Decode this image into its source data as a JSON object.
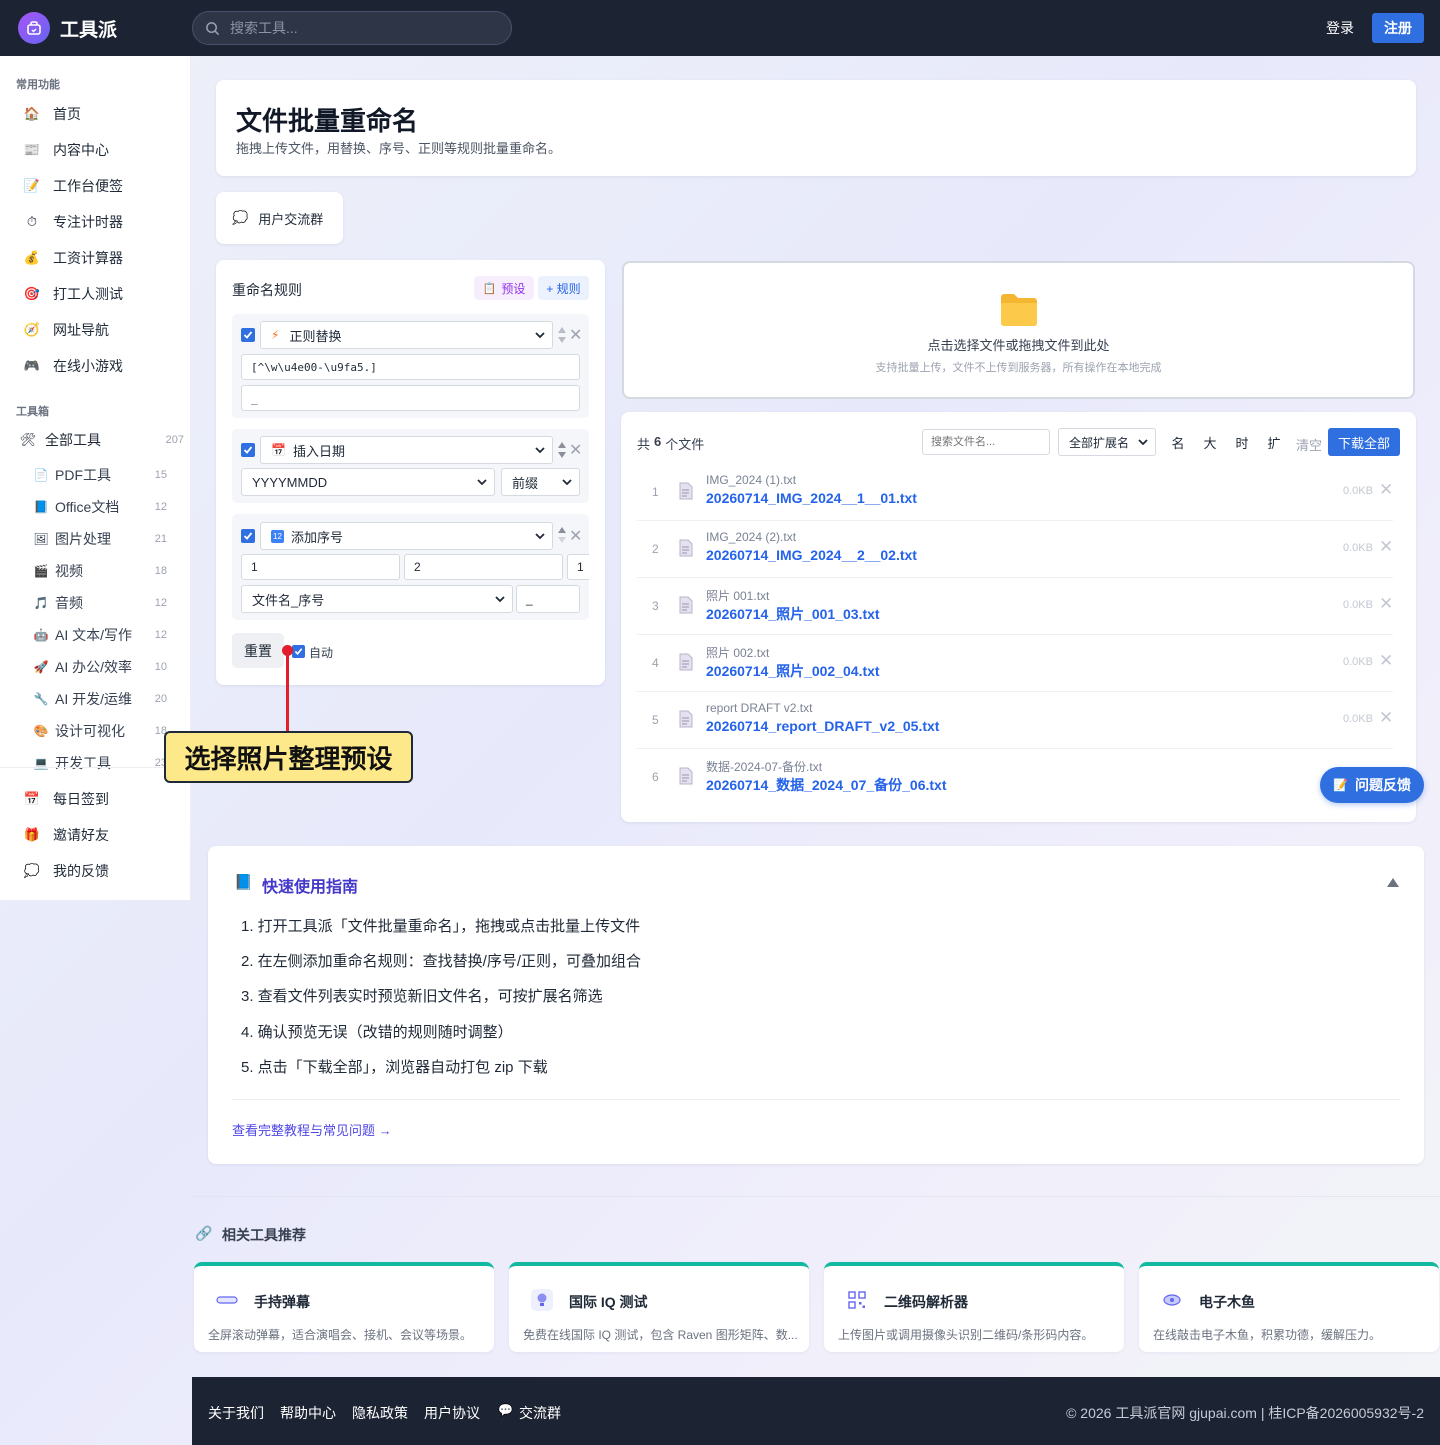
{
  "header": {
    "brand": "工具派",
    "search_placeholder": "搜索工具...",
    "login": "登录",
    "signup": "注册"
  },
  "sidebar": {
    "section_common": "常用功能",
    "common_items": [
      {
        "label": "首页",
        "icon": "house-icon"
      },
      {
        "label": "内容中心",
        "icon": "newspaper-icon"
      },
      {
        "label": "工作台便签",
        "icon": "memo-icon"
      },
      {
        "label": "专注计时器",
        "icon": "stopwatch-icon"
      },
      {
        "label": "工资计算器",
        "icon": "money-bag-icon"
      },
      {
        "label": "打工人测试",
        "icon": "target-icon"
      },
      {
        "label": "网址导航",
        "icon": "compass-icon"
      },
      {
        "label": "在线小游戏",
        "icon": "gamepad-icon"
      }
    ],
    "section_tools": "工具箱",
    "all_tools": {
      "label": "全部工具",
      "count": "207"
    },
    "tool_items": [
      {
        "label": "PDF工具",
        "count": "15"
      },
      {
        "label": "Office文档",
        "count": "12"
      },
      {
        "label": "图片处理",
        "count": "21"
      },
      {
        "label": "视频",
        "count": "18"
      },
      {
        "label": "音频",
        "count": "12"
      },
      {
        "label": "AI 文本/写作",
        "count": "12"
      },
      {
        "label": "AI 办公/效率",
        "count": "10"
      },
      {
        "label": "AI 开发/运维",
        "count": "20"
      },
      {
        "label": "设计可视化",
        "count": "18"
      },
      {
        "label": "开发工具",
        "count": "23"
      }
    ],
    "bottom_items": [
      {
        "label": "每日签到",
        "icon": "calendar-icon"
      },
      {
        "label": "邀请好友",
        "icon": "gift-icon"
      },
      {
        "label": "我的反馈",
        "icon": "speech-bubble-icon"
      }
    ]
  },
  "page": {
    "title": "文件批量重命名",
    "subtitle": "拖拽上传文件，用替换、序号、正则等规则批量重命名。",
    "group_button": "用户交流群"
  },
  "rules": {
    "title": "重命名规则",
    "preset_btn": "预设",
    "add_rule_btn": "+ 规则",
    "rule1": {
      "type": "正则替换",
      "pattern": "[^\\w\\u4e00-\\u9fa5.]",
      "replacement": "_"
    },
    "rule2": {
      "type": "插入日期",
      "format": "YYYYMMDD",
      "position": "前缀"
    },
    "rule3": {
      "type": "添加序号",
      "start": "1",
      "digits": "2",
      "step": "1",
      "template": "文件名_序号",
      "separator": "_"
    },
    "reset_btn": "重置",
    "auto_label": "自动"
  },
  "upload": {
    "main": "点击选择文件或拖拽文件到此处",
    "hint": "支持批量上传，文件不上传到服务器，所有操作在本地完成"
  },
  "files": {
    "count_prefix": "共",
    "count": "6",
    "count_suffix": "个文件",
    "search_placeholder": "搜索文件名...",
    "ext_filter": "全部扩展名",
    "sort_buttons": [
      "名",
      "大",
      "时",
      "扩"
    ],
    "clear": "清空",
    "download_all": "下载全部",
    "list": [
      {
        "idx": "1",
        "old": "IMG_2024 (1).txt",
        "new": "20260714_IMG_2024__1__01.txt",
        "size": "0.0KB"
      },
      {
        "idx": "2",
        "old": "IMG_2024 (2).txt",
        "new": "20260714_IMG_2024__2__02.txt",
        "size": "0.0KB"
      },
      {
        "idx": "3",
        "old": "照片 001.txt",
        "new": "20260714_照片_001_03.txt",
        "size": "0.0KB"
      },
      {
        "idx": "4",
        "old": "照片 002.txt",
        "new": "20260714_照片_002_04.txt",
        "size": "0.0KB"
      },
      {
        "idx": "5",
        "old": "report DRAFT v2.txt",
        "new": "20260714_report_DRAFT_v2_05.txt",
        "size": "0.0KB"
      },
      {
        "idx": "6",
        "old": "数据-2024-07-备份.txt",
        "new": "20260714_数据_2024_07_备份_06.txt",
        "size": ""
      }
    ]
  },
  "feedback_btn": "问题反馈",
  "annotation": "选择照片整理预设",
  "guide": {
    "title": "快速使用指南",
    "steps": [
      "1. 打开工具派「文件批量重命名」，拖拽或点击批量上传文件",
      "2. 在左侧添加重命名规则：查找替换/序号/正则，可叠加组合",
      "3. 查看文件列表实时预览新旧文件名，可按扩展名筛选",
      "4. 确认预览无误（改错的规则随时调整）",
      "5. 点击「下载全部」，浏览器自动打包 zip 下载"
    ],
    "more_link": "查看完整教程与常见问题 →"
  },
  "related": {
    "title": "相关工具推荐",
    "items": [
      {
        "title": "手持弹幕",
        "desc": "全屏滚动弹幕，适合演唱会、接机、会议等场景。"
      },
      {
        "title": "国际 IQ 测试",
        "desc": "免费在线国际 IQ 测试，包含 Raven 图形矩阵、数..."
      },
      {
        "title": "二维码解析器",
        "desc": "上传图片或调用摄像头识别二维码/条形码内容。"
      },
      {
        "title": "电子木鱼",
        "desc": "在线敲击电子木鱼，积累功德，缓解压力。"
      }
    ]
  },
  "footer": {
    "links": [
      "关于我们",
      "帮助中心",
      "隐私政策",
      "用户协议",
      "交流群"
    ],
    "copyright": "© 2026 工具派官网 gjupai.com | 桂ICP备2026005932号-2"
  },
  "colors": {
    "accent": "#2f6fe0",
    "dark": "#1c2333",
    "link": "#2563eb",
    "teal": "#10b9a0"
  }
}
